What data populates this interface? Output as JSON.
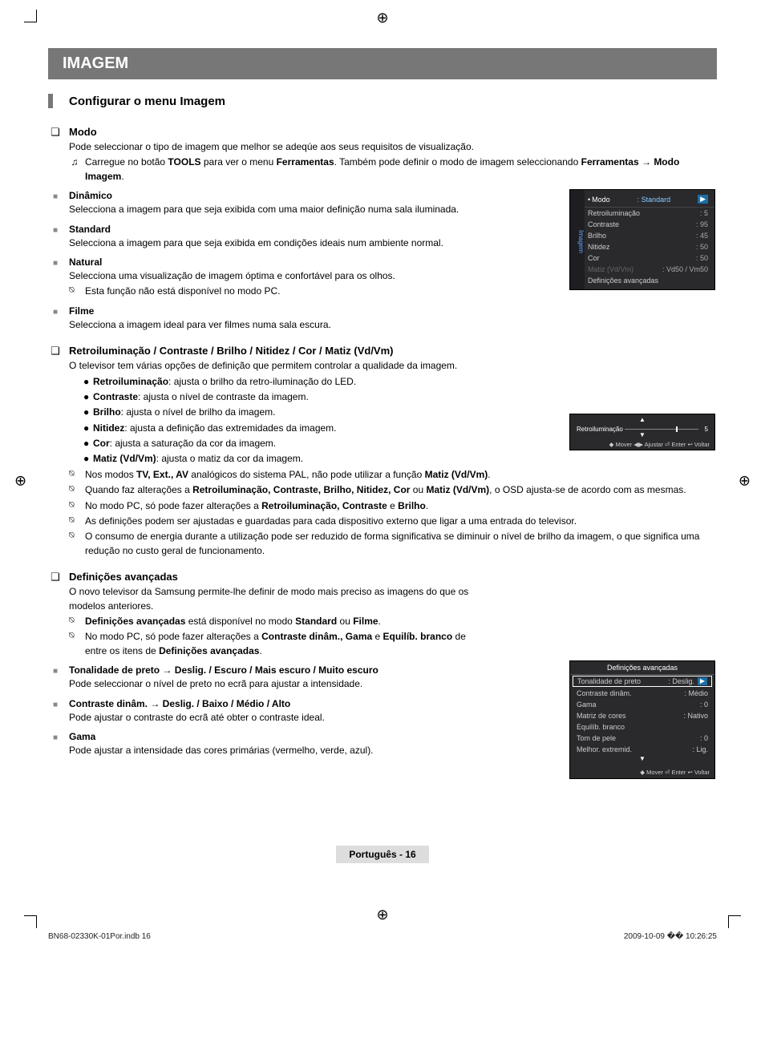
{
  "header": {
    "title": "IMAGEM",
    "subtitle": "Configurar o menu Imagem"
  },
  "modo": {
    "title": "Modo",
    "intro": "Pode seleccionar o tipo de imagem que melhor se adeqúe aos seus requisitos de visualização.",
    "tools_pre": "Carregue no botão ",
    "tools_b1": "TOOLS",
    "tools_mid1": " para ver o menu ",
    "tools_b2": "Ferramentas",
    "tools_mid2": ". Também pode definir o modo de imagem seleccionando ",
    "tools_b3": "Ferramentas → Modo Imagem",
    "tools_end": "."
  },
  "dinamico": {
    "title": "Dinâmico",
    "body": "Selecciona a imagem para que seja exibida com uma maior definição numa sala iluminada."
  },
  "standard": {
    "title": "Standard",
    "body": "Selecciona a imagem para que seja exibida em condições ideais num ambiente normal."
  },
  "natural": {
    "title": "Natural",
    "body": "Selecciona uma visualização de imagem óptima e confortável para os olhos.",
    "note": "Esta função não está disponível no modo PC."
  },
  "filme": {
    "title": "Filme",
    "body": "Selecciona a imagem ideal para ver filmes numa sala escura."
  },
  "retro": {
    "title": "Retroiluminação / Contraste / Brilho / Nitidez / Cor / Matiz (Vd/Vm)",
    "intro": "O televisor tem várias opções de definição que permitem controlar a qualidade da imagem.",
    "items": [
      {
        "b": "Retroiluminação",
        "t": ": ajusta o brilho da retro-iluminação do LED."
      },
      {
        "b": "Contraste",
        "t": ": ajusta o nível de contraste da imagem."
      },
      {
        "b": "Brilho",
        "t": ": ajusta o nível de brilho da imagem."
      },
      {
        "b": "Nitidez",
        "t": ": ajusta a definição das extremidades da imagem."
      },
      {
        "b": "Cor",
        "t": ": ajusta a saturação da cor da imagem."
      },
      {
        "b": "Matiz (Vd/Vm)",
        "t": ": ajusta o matiz da cor da imagem."
      }
    ],
    "n1a": "Nos modos ",
    "n1b": "TV, Ext., AV",
    "n1c": " analógicos do sistema PAL, não pode utilizar a função ",
    "n1d": "Matiz (Vd/Vm)",
    "n1e": ".",
    "n2a": "Quando faz alterações a ",
    "n2b": "Retroiluminação, Contraste, Brilho, Nitidez, Cor",
    "n2c": " ou ",
    "n2d": "Matiz (Vd/Vm)",
    "n2e": ", o OSD ajusta-se de acordo com as mesmas.",
    "n3a": "No modo PC, só pode fazer alterações a ",
    "n3b": "Retroiluminação, Contraste",
    "n3c": " e ",
    "n3d": "Brilho",
    "n3e": ".",
    "n4": "As definições podem ser ajustadas e guardadas para cada dispositivo externo que ligar a uma entrada do televisor.",
    "n5": "O consumo de energia durante a utilização pode ser reduzido de forma significativa se diminuir o nível de brilho da imagem, o que significa uma redução no custo geral de funcionamento."
  },
  "def": {
    "title": "Definições avançadas",
    "intro": "O novo televisor da Samsung permite-lhe definir de modo mais preciso as imagens do que os modelos anteriores.",
    "n1a": "Definições avançadas",
    "n1b": " está disponível no modo ",
    "n1c": "Standard",
    "n1d": " ou ",
    "n1e": "Filme",
    "n2a": "No modo PC, só pode fazer alterações a ",
    "n2b": "Contraste dinâm., Gama",
    "n2c": " e ",
    "n2d": "Equilíb. branco",
    "n2e": " de entre os itens de ",
    "n2f": "Definições avançadas",
    "sub1t": "Tonalidade de preto → Deslig. / Escuro / Mais escuro / Muito escuro",
    "sub1b": "Pode seleccionar o nível de preto no ecrã para ajustar a intensidade.",
    "sub2t": "Contraste dinâm. → Deslig. / Baixo / Médio / Alto",
    "sub2b": "Pode ajustar o contraste do ecrã até obter o contraste ideal.",
    "sub3t": "Gama",
    "sub3b": "Pode ajustar a intensidade das cores primárias (vermelho, verde, azul)."
  },
  "osd1": {
    "side": "Imagem",
    "mode": "Modo",
    "mode_v": "Standard",
    "rows": [
      [
        "Retroiluminação",
        "5"
      ],
      [
        "Contraste",
        "95"
      ],
      [
        "Brilho",
        "45"
      ],
      [
        "Nitidez",
        "50"
      ],
      [
        "Cor",
        "50"
      ],
      [
        "Matiz (Vd/Vm)",
        "Vd50 / Vm50"
      ],
      [
        "Definições avançadas",
        ""
      ]
    ]
  },
  "osd_slim": {
    "label": "Retroiluminação",
    "value": "5",
    "footer": "◆ Mover   ◀▶ Ajustar   ⏎ Enter   ↩ Voltar"
  },
  "osd2": {
    "title": "Definições avançadas",
    "rows": [
      [
        "Tonalidade de preto",
        "Deslig."
      ],
      [
        "Contraste dinâm.",
        "Médio"
      ],
      [
        "Gama",
        "0"
      ],
      [
        "Matriz de cores",
        "Nativo"
      ],
      [
        "Equilíb. branco",
        ""
      ],
      [
        "Tom de pele",
        "0"
      ],
      [
        "Melhor. extremid.",
        "Lig."
      ]
    ],
    "triangle": "▼",
    "footer": "◆ Mover   ⏎ Enter   ↩ Voltar"
  },
  "pager": {
    "lang": "Português - ",
    "num": "16"
  },
  "footer": {
    "left": "BN68-02330K-01Por.indb   16",
    "right": "2009-10-09   �� 10:26:25"
  }
}
